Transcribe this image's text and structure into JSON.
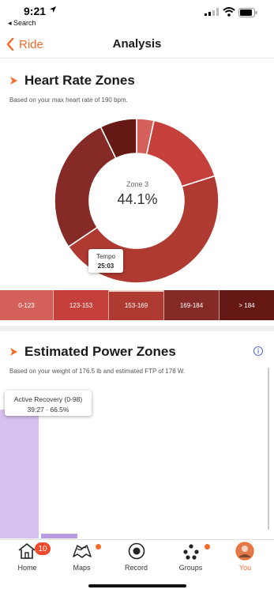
{
  "status_bar": {
    "time": "9:21",
    "back_app": "◂ Search"
  },
  "nav": {
    "back_label": "Ride",
    "title": "Analysis"
  },
  "hr_section": {
    "title": "Heart Rate Zones",
    "subtitle": "Based on your max heart rate of 190 bpm.",
    "center_label": "Zone 3",
    "center_value": "44.1%",
    "tooltip_title": "Tempo",
    "tooltip_value": "25:03",
    "zones": [
      {
        "label": "0-123",
        "percent": 3.3,
        "color": "#d4605a"
      },
      {
        "label": "123-153",
        "percent": 16.2,
        "color": "#c5403a"
      },
      {
        "label": "153-169",
        "percent": 44.1,
        "color": "#ae3a32"
      },
      {
        "label": "169-184",
        "percent": 26.4,
        "color": "#862a27"
      },
      {
        "label": "> 184",
        "percent": 7.0,
        "color": "#661914"
      }
    ]
  },
  "power_section": {
    "title": "Estimated Power Zones",
    "subtitle": "Based on your weight of 176.5 lb and estimated FTP of 178 W.",
    "tooltip_title": "Active Recovery (0-98)",
    "tooltip_value": "39:27 · 66.5%",
    "bar_color": "#d6c0f0"
  },
  "tabbar": {
    "items": [
      {
        "label": "Home",
        "badge": "10"
      },
      {
        "label": "Maps"
      },
      {
        "label": "Record"
      },
      {
        "label": "Groups"
      },
      {
        "label": "You"
      }
    ],
    "accent": "#f26b2a"
  }
}
